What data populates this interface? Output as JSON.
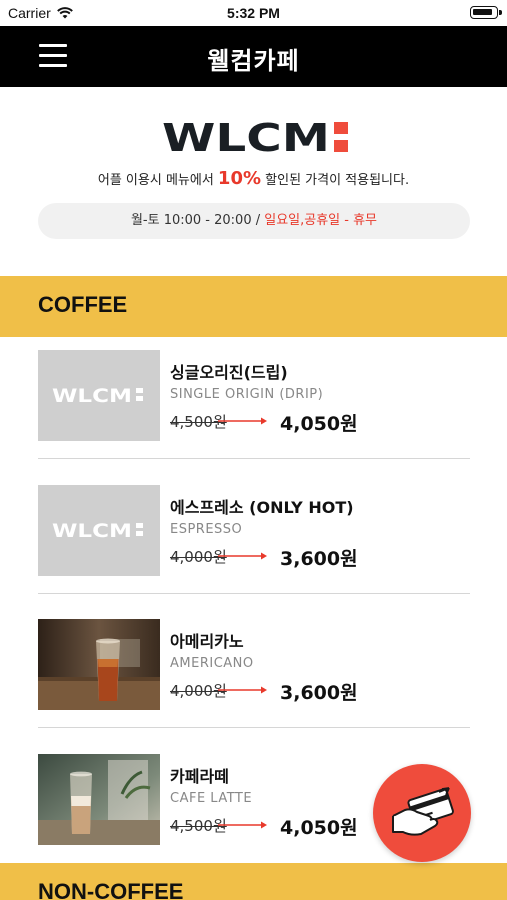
{
  "status_bar": {
    "carrier": "Carrier",
    "time": "5:32 PM"
  },
  "nav": {
    "title": "웰컴카페",
    "menu_icon": "hamburger-menu-icon"
  },
  "hero": {
    "logo_text": "WLCM:",
    "discount_prefix": "어플 이용시 메뉴에서 ",
    "discount_percent": "10%",
    "discount_suffix": " 할인된 가격이 적용됩니다.",
    "hours_open": "월-토 10:00 - 20:00 / ",
    "hours_closed": "일요일,공휴일 - 휴무"
  },
  "sections": [
    {
      "title": "COFFEE",
      "items": [
        {
          "name": "싱글오리진(드립)",
          "english": "SINGLE ORIGIN (DRIP)",
          "original_price": "4,500원",
          "sale_price": "4,050원",
          "image": "placeholder-logo"
        },
        {
          "name": "에스프레소 (ONLY HOT)",
          "english": "ESPRESSO",
          "original_price": "4,000원",
          "sale_price": "3,600원",
          "image": "placeholder-logo"
        },
        {
          "name": "아메리카노",
          "english": "AMERICANO",
          "original_price": "4,000원",
          "sale_price": "3,600원",
          "image": "iced-americano-photo"
        },
        {
          "name": "카페라떼",
          "english": "CAFE LATTE",
          "original_price": "4,500원",
          "sale_price": "4,050원",
          "image": "cafe-latte-photo"
        }
      ]
    },
    {
      "title": "NON-COFFEE",
      "items": []
    }
  ],
  "placeholder_logo_text": "WLCM:",
  "fab": {
    "icon": "card-payment-icon"
  },
  "colors": {
    "accent_yellow": "#f0bf48",
    "accent_red": "#e8392b",
    "nav_black": "#000000"
  }
}
